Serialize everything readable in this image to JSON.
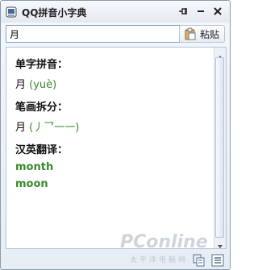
{
  "window": {
    "title": "QQ拼音小字典",
    "buttons": [
      "pin",
      "minimize",
      "close"
    ]
  },
  "search": {
    "value": "月",
    "paste_label": "粘贴"
  },
  "content": {
    "pinyin": {
      "label": "单字拼音：",
      "character": "月",
      "reading": "(yuè)"
    },
    "strokes": {
      "label": "笔画拆分：",
      "character": "月",
      "open": "(",
      "parts": "丿乛一一",
      "close": ")"
    },
    "translation": {
      "label": "汉英翻译：",
      "words": [
        "month",
        "moon"
      ]
    }
  },
  "watermark": {
    "main": "PConline",
    "sub": "太平洋电脑网"
  },
  "colors": {
    "accent_green": "#3a8a2a",
    "border": "#8a9aad"
  },
  "icons": [
    "dictionary-app-icon",
    "pin-icon",
    "minimize-icon",
    "close-icon",
    "paste-icon",
    "copy-icon",
    "list-icon"
  ]
}
